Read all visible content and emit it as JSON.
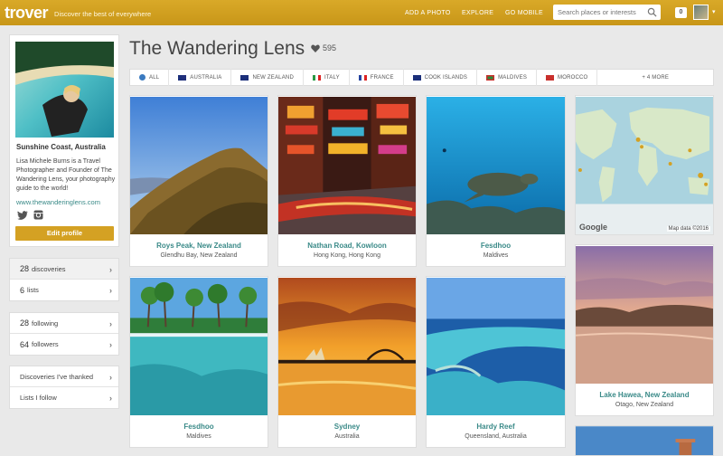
{
  "header": {
    "logo": "trover",
    "tagline": "Discover the best of everywhere",
    "nav": [
      "ADD A PHOTO",
      "EXPLORE",
      "GO MOBILE"
    ],
    "search_placeholder": "Search places or interests",
    "notifications": "0"
  },
  "profile": {
    "location": "Sunshine Coast, Australia",
    "bio": "Lisa Michele Burns is a Travel Photographer and Founder of The Wandering Lens, your photography guide to the world!",
    "website": "www.thewanderinglens.com",
    "edit_label": "Edit profile"
  },
  "stats": {
    "discoveries_num": "28",
    "discoveries_label": "discoveries",
    "lists_num": "6",
    "lists_label": "lists",
    "following_num": "28",
    "following_label": "following",
    "followers_num": "64",
    "followers_label": "followers",
    "thanked": "Discoveries I've thanked",
    "lists_follow": "Lists I follow"
  },
  "page": {
    "title": "The Wandering Lens",
    "likes": "595"
  },
  "tabs": [
    "ALL",
    "AUSTRALIA",
    "NEW ZEALAND",
    "ITALY",
    "FRANCE",
    "COOK ISLANDS",
    "MALDIVES",
    "MOROCCO",
    "+ 4 MORE"
  ],
  "cards": [
    {
      "title": "Roys Peak, New Zealand",
      "sub": "Glendhu Bay, New Zealand"
    },
    {
      "title": "Nathan Road, Kowloon",
      "sub": "Hong Kong, Hong Kong"
    },
    {
      "title": "Fesdhoo",
      "sub": "Maldives"
    },
    {
      "title": "Fesdhoo",
      "sub": "Maldives"
    },
    {
      "title": "Sydney",
      "sub": "Australia"
    },
    {
      "title": "Hardy Reef",
      "sub": "Queensland, Australia"
    },
    {
      "title": "Lake Hawea, New Zealand",
      "sub": "Otago, New Zealand"
    }
  ],
  "map": {
    "credit": "Map data ©2016",
    "brand": "Google"
  },
  "colors": {
    "brand": "#d4a123",
    "link": "#3a8a88"
  }
}
